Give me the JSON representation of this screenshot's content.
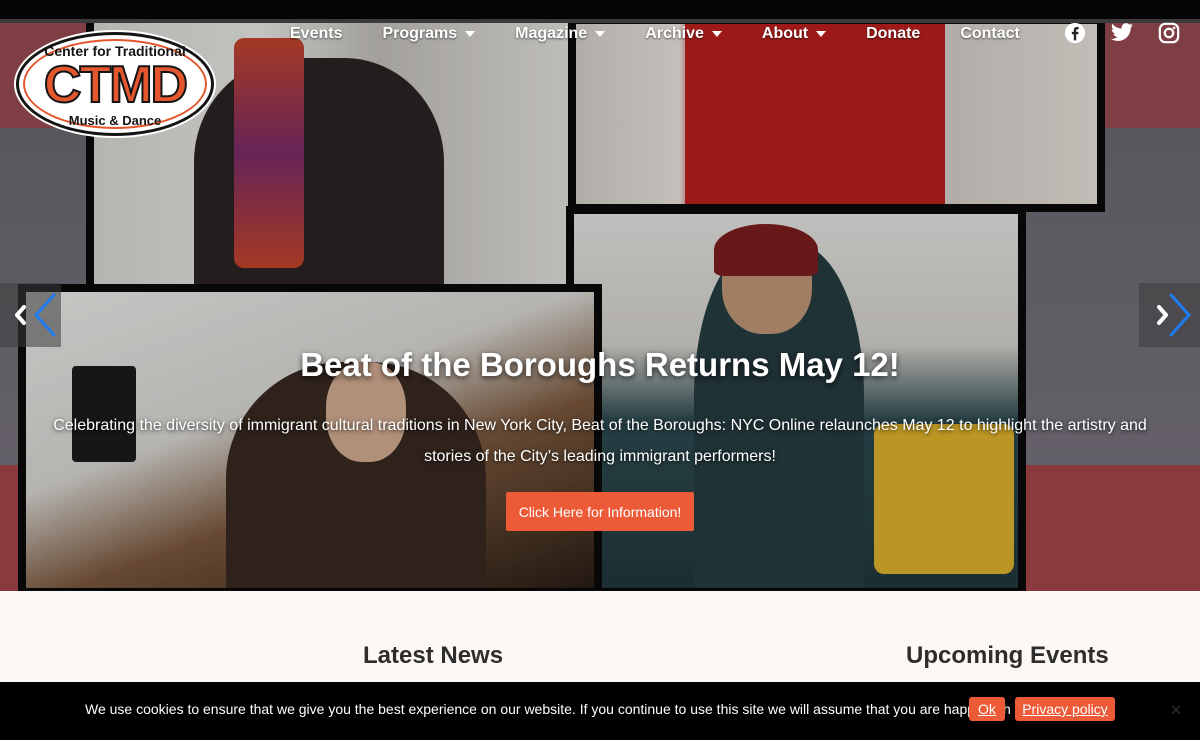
{
  "logo": {
    "top_text": "Center for Traditional",
    "mid_text": "CTMD",
    "bottom_text": "Music & Dance"
  },
  "nav": {
    "items": [
      {
        "label": "Events",
        "has_dropdown": false
      },
      {
        "label": "Programs",
        "has_dropdown": true
      },
      {
        "label": "Magazine",
        "has_dropdown": true
      },
      {
        "label": "Archive",
        "has_dropdown": true
      },
      {
        "label": "About",
        "has_dropdown": true
      },
      {
        "label": "Donate",
        "has_dropdown": false
      },
      {
        "label": "Contact",
        "has_dropdown": false
      }
    ],
    "social": [
      "facebook-icon",
      "twitter-icon",
      "instagram-icon"
    ]
  },
  "hero": {
    "title": "Beat of the Boroughs Returns May 12!",
    "description": "Celebrating the diversity of immigrant cultural traditions in New York City, Beat of the Boroughs: NYC Online relaunches May 12 to highlight the artistry and stories of the City’s leading immigrant performers!",
    "button_label": "Click Here for Information!",
    "prev_icon": "chevron-left-icon",
    "next_icon": "chevron-right-icon"
  },
  "sections": {
    "latest_news": "Latest News",
    "upcoming_events": "Upcoming Events"
  },
  "cookie": {
    "text": "We use cookies to ensure that we give you the best experience on our website. If you continue to use this site we will assume that you are happy with it.",
    "ok_label": "Ok",
    "privacy_label": "Privacy policy",
    "close_label": "×"
  },
  "colors": {
    "accent": "#ec5a37",
    "cookie_bg": "#000000",
    "page_bg": "#fdf8f3"
  }
}
